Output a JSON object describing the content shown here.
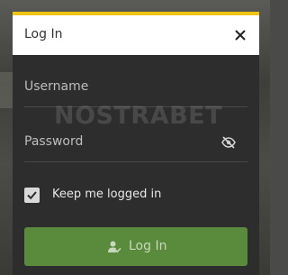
{
  "modal": {
    "title": "Log In",
    "accent_color": "#f1c40f",
    "close_icon": "close-icon"
  },
  "form": {
    "username_label": "Username",
    "password_label": "Password",
    "password_toggle_icon": "eye-slash-icon",
    "remember_label": "Keep me logged in",
    "remember_checked": true,
    "submit_label": "Log In",
    "submit_icon": "user-check-icon",
    "submit_color": "#5a8a3c"
  },
  "watermark": "NOSTRABET"
}
